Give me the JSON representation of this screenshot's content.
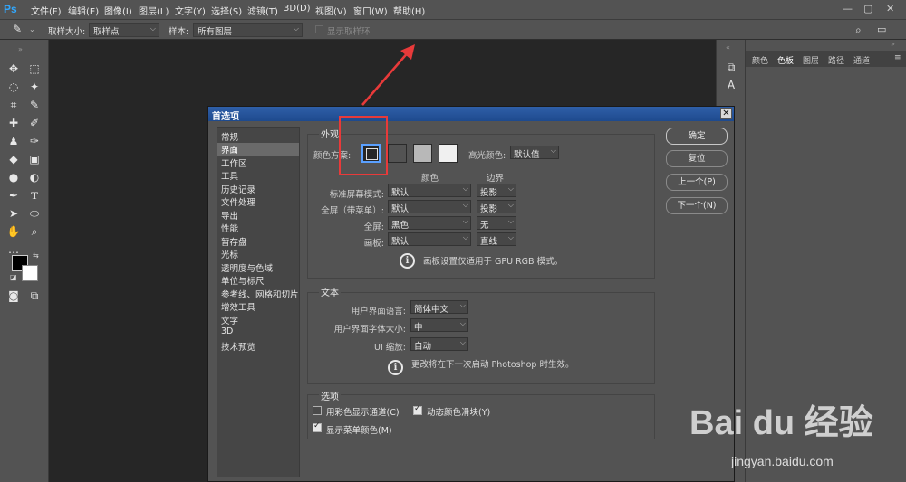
{
  "app": {
    "logo": "Ps"
  },
  "menubar": {
    "items": [
      "文件(F)",
      "编辑(E)",
      "图像(I)",
      "图层(L)",
      "文字(Y)",
      "选择(S)",
      "滤镜(T)",
      "3D(D)",
      "视图(V)",
      "窗口(W)",
      "帮助(H)"
    ],
    "window_controls": [
      "—",
      "▢",
      "✕"
    ]
  },
  "optionsbar": {
    "sample_size_label": "取样大小:",
    "sample_size_value": "取样点",
    "sample_label": "样本:",
    "sample_value": "所有图层",
    "show_ring_label": "显示取样环"
  },
  "panel": {
    "tabs": [
      "颜色",
      "色板",
      "图层",
      "路径",
      "通道"
    ],
    "active_tab": "色板"
  },
  "dialog": {
    "title": "首选项",
    "close": "✕",
    "categories": [
      "常规",
      "界面",
      "工作区",
      "工具",
      "历史记录",
      "文件处理",
      "导出",
      "性能",
      "暂存盘",
      "光标",
      "透明度与色域",
      "单位与标尺",
      "参考线、网格和切片",
      "增效工具",
      "文字",
      "3D",
      "技术预览"
    ],
    "selected_category": "界面",
    "buttons": {
      "ok": "确定",
      "reset": "复位",
      "prev": "上一个(P)",
      "next": "下一个(N)"
    },
    "appearance": {
      "title": "外观",
      "color_theme_label": "颜色方案:",
      "themes": [
        "#262626",
        "#535353",
        "#b8b8b8",
        "#f0f0f0"
      ],
      "highlight_label": "高光颜色:",
      "highlight_value": "默认值",
      "col_color": "颜色",
      "col_border": "边界",
      "rows": [
        {
          "label": "标准屏幕模式:",
          "color": "默认",
          "border": "投影"
        },
        {
          "label": "全屏（带菜单）:",
          "color": "默认",
          "border": "投影"
        },
        {
          "label": "全屏:",
          "color": "黑色",
          "border": "无"
        },
        {
          "label": "画板:",
          "color": "默认",
          "border": "直线"
        }
      ],
      "note": "画板设置仅适用于 GPU RGB 模式。"
    },
    "text": {
      "title": "文本",
      "ui_language_label": "用户界面语言:",
      "ui_language_value": "简体中文",
      "ui_font_size_label": "用户界面字体大小:",
      "ui_font_size_value": "中",
      "ui_scale_label": "UI 缩放:",
      "ui_scale_value": "自动",
      "note": "更改将在下一次启动 Photoshop 时生效。"
    },
    "options": {
      "title": "选项",
      "items": [
        {
          "label": "用彩色显示通道(C)",
          "checked": false
        },
        {
          "label": "动态颜色滑块(Y)",
          "checked": true
        },
        {
          "label": "显示菜单颜色(M)",
          "checked": true
        }
      ]
    }
  },
  "watermark": {
    "brand": "Bai du 经验",
    "url": "jingyan.baidu.com"
  },
  "colors": {
    "annotation": "#e83a3a",
    "ps_blue": "#31a8ff"
  }
}
